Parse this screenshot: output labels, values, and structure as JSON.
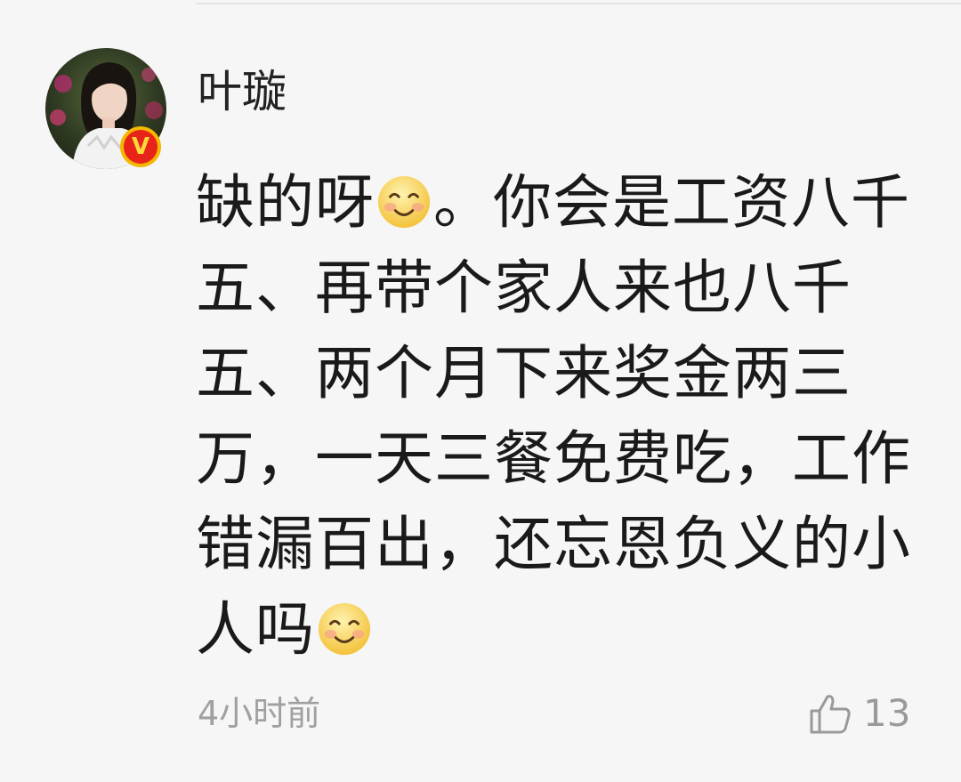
{
  "comment": {
    "username": "叶璇",
    "badge_letter": "V",
    "text_lines": [
      "缺的呀",
      "。你会是工资八千",
      "五、再带个家人来也八千",
      "五、两个月下来奖金两三",
      "万，一天三餐免费吃，工作",
      "错漏百出，还忘恩负义的小",
      "人吗"
    ],
    "timestamp": "4小时前",
    "like_count": "13"
  },
  "icons": {
    "avatar": "user-avatar-photo",
    "verified": "verified-v-badge-icon",
    "emoji": "smiling-face-emoji",
    "like": "thumbs-up-icon"
  },
  "colors": {
    "background": "#f6f6f6",
    "text": "#1a1a1a",
    "meta": "#a0a0a0",
    "badge_red": "#e8231a",
    "badge_gold": "#f5b700"
  }
}
